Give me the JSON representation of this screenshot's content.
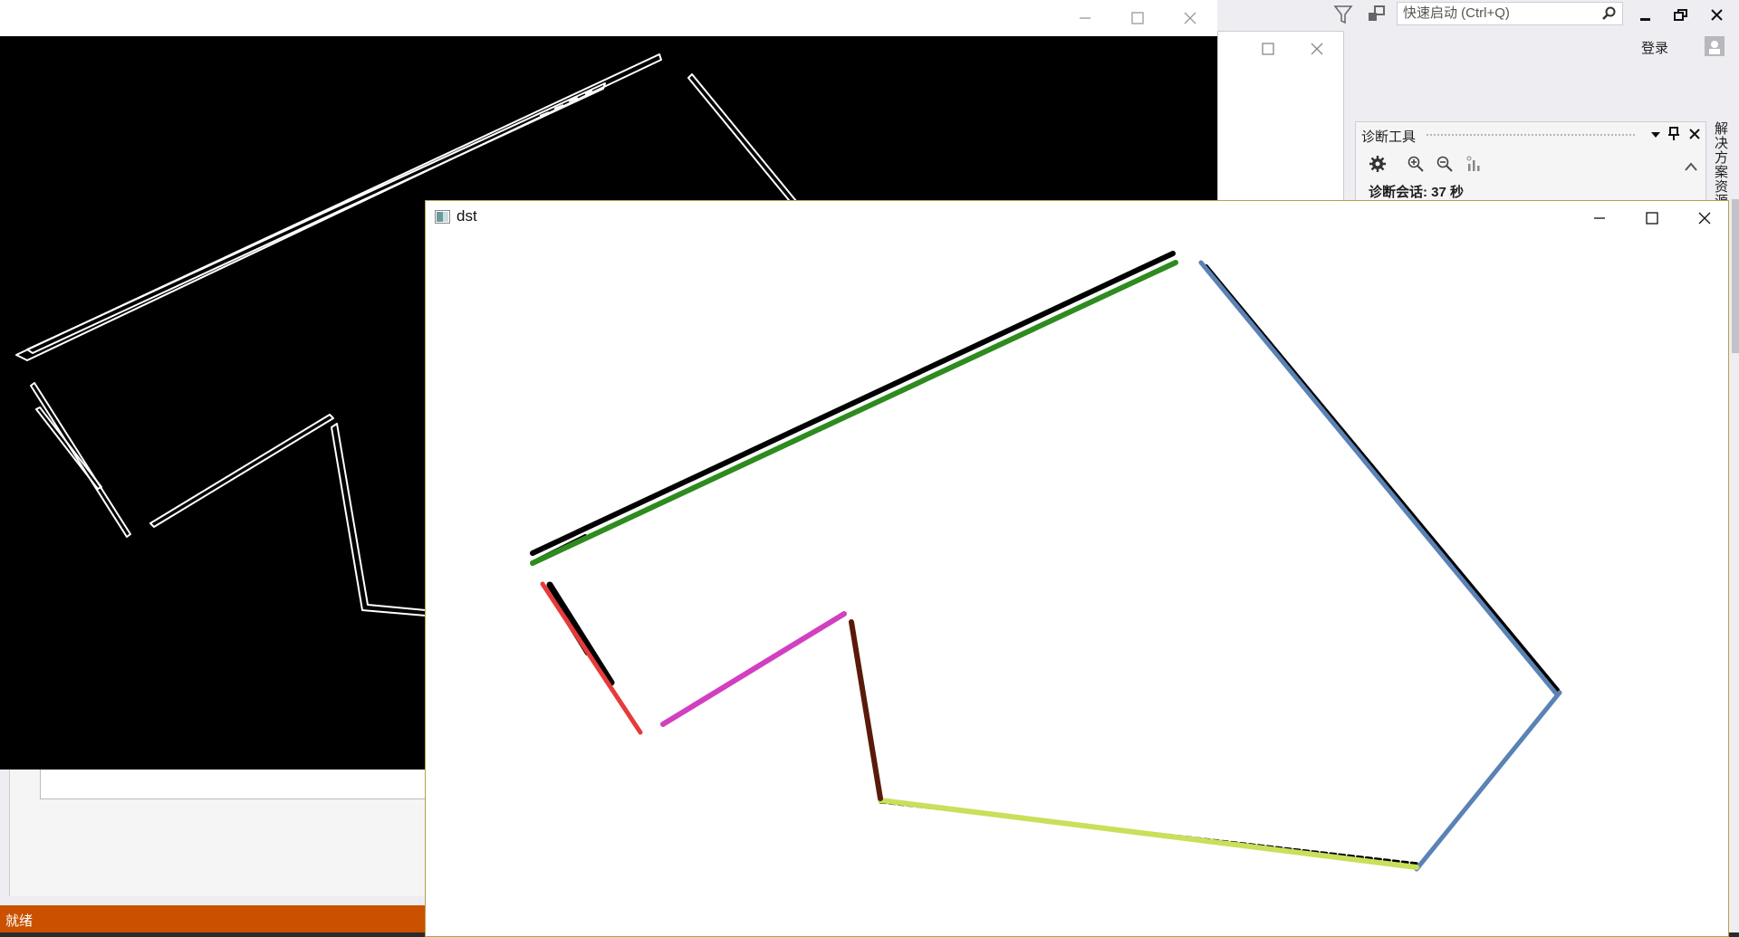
{
  "vs": {
    "quick_launch_placeholder": "快速启动 (Ctrl+Q)",
    "login_label": "登录",
    "diag_title": "诊断工具",
    "diag_session": "诊断会话: 37 秒",
    "side_tab_label": "解决方案资源",
    "status_text": "就绪",
    "status_color": "#ca5100"
  },
  "dst_window": {
    "title": "dst",
    "border_color": "#b9a04a"
  },
  "icons": [
    "filter-icon",
    "feedback-icon",
    "search-icon",
    "minimize-icon",
    "restore-icon",
    "close-icon",
    "account-icon",
    "settings-gear-icon",
    "zoom-in-icon",
    "zoom-out-icon",
    "chart-icon",
    "pin-icon",
    "dropdown-icon",
    "app-icon",
    "maximize-icon",
    "chevron-up-icon"
  ],
  "line_colors": {
    "top_line": "#2e8b1e",
    "right_upper": "#5b82b5",
    "right_lower": "#5b82b5",
    "bottom": "#c8e05a",
    "v_edge": "#5a1a0a",
    "pink": "#d23fc0",
    "red": "#e83a3a",
    "black": "#000000"
  }
}
